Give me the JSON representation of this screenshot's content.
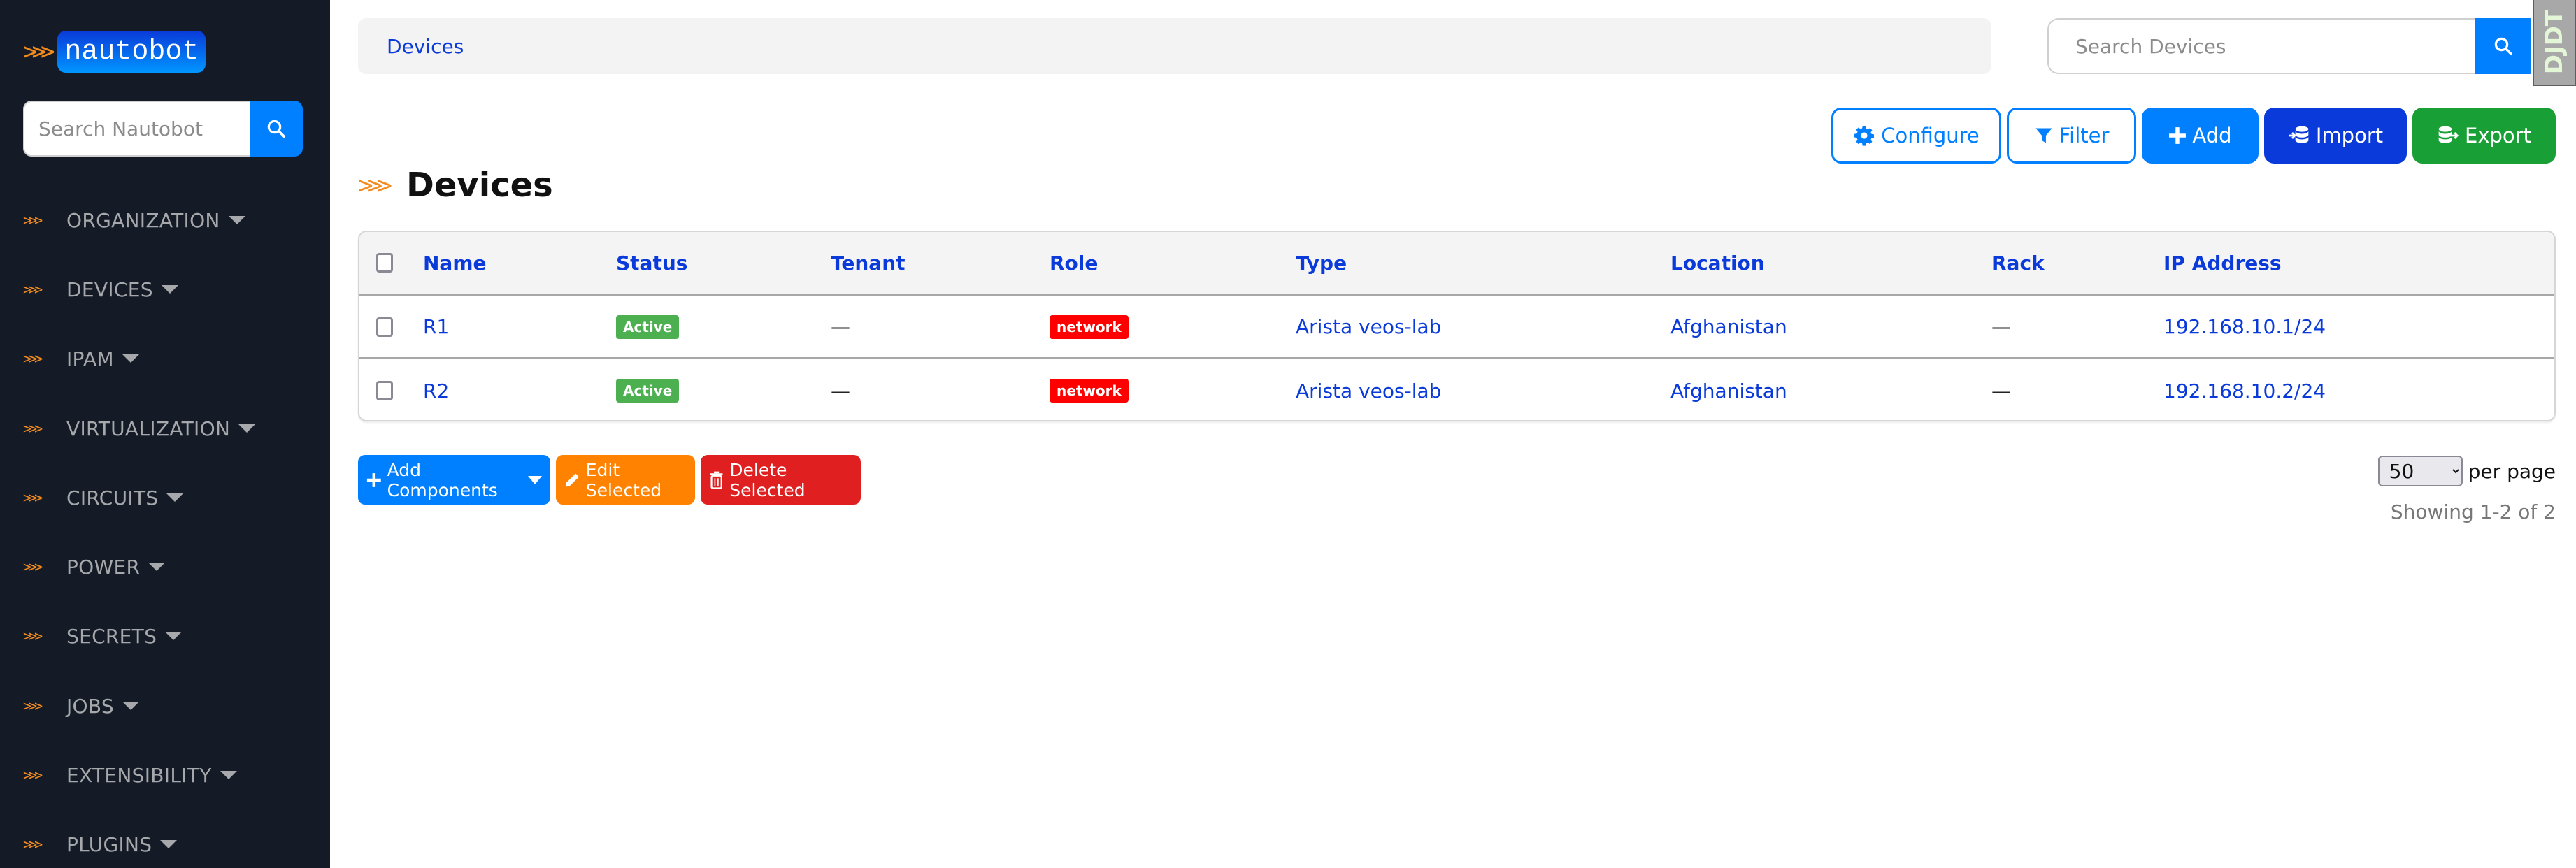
{
  "app": {
    "logo_text": "nautobot",
    "logo_prefix": ">>>",
    "search_placeholder": "Search Nautobot"
  },
  "sidebar": {
    "items": [
      {
        "label": "ORGANIZATION"
      },
      {
        "label": "DEVICES"
      },
      {
        "label": "IPAM"
      },
      {
        "label": "VIRTUALIZATION"
      },
      {
        "label": "CIRCUITS"
      },
      {
        "label": "POWER"
      },
      {
        "label": "SECRETS"
      },
      {
        "label": "JOBS"
      },
      {
        "label": "EXTENSIBILITY"
      },
      {
        "label": "PLUGINS"
      }
    ]
  },
  "breadcrumb": {
    "items": [
      "Devices"
    ]
  },
  "top_search": {
    "placeholder": "Search Devices"
  },
  "debug_toolbar": {
    "label": "DJDT"
  },
  "actions": {
    "configure": "Configure",
    "filter": "Filter",
    "add": "Add",
    "import": "Import",
    "export": "Export"
  },
  "page": {
    "title": "Devices",
    "title_prefix": ">>>"
  },
  "table": {
    "columns": [
      "Name",
      "Status",
      "Tenant",
      "Role",
      "Type",
      "Location",
      "Rack",
      "IP Address"
    ],
    "rows": [
      {
        "name": "R1",
        "status": "Active",
        "tenant": "—",
        "role": "network",
        "type": "Arista veos-lab",
        "location": "Afghanistan",
        "rack": "—",
        "ip": "192.168.10.1/24"
      },
      {
        "name": "R2",
        "status": "Active",
        "tenant": "—",
        "role": "network",
        "type": "Arista veos-lab",
        "location": "Afghanistan",
        "rack": "—",
        "ip": "192.168.10.2/24"
      }
    ]
  },
  "bulk_actions": {
    "add_components": "Add Components",
    "edit_selected": "Edit Selected",
    "delete_selected": "Delete Selected"
  },
  "pagination": {
    "per_page_value": "50",
    "per_page_label": "per page",
    "showing": "Showing 1-2 of 2"
  },
  "colors": {
    "sidebar_bg": "#141b26",
    "accent_orange": "#f48b1e",
    "primary": "#0080ff",
    "navy": "#0a3ad9",
    "success": "#189f35",
    "status_active": "#4caf50",
    "role_network": "#ff0000",
    "edit": "#ff8300",
    "delete": "#e02020"
  }
}
